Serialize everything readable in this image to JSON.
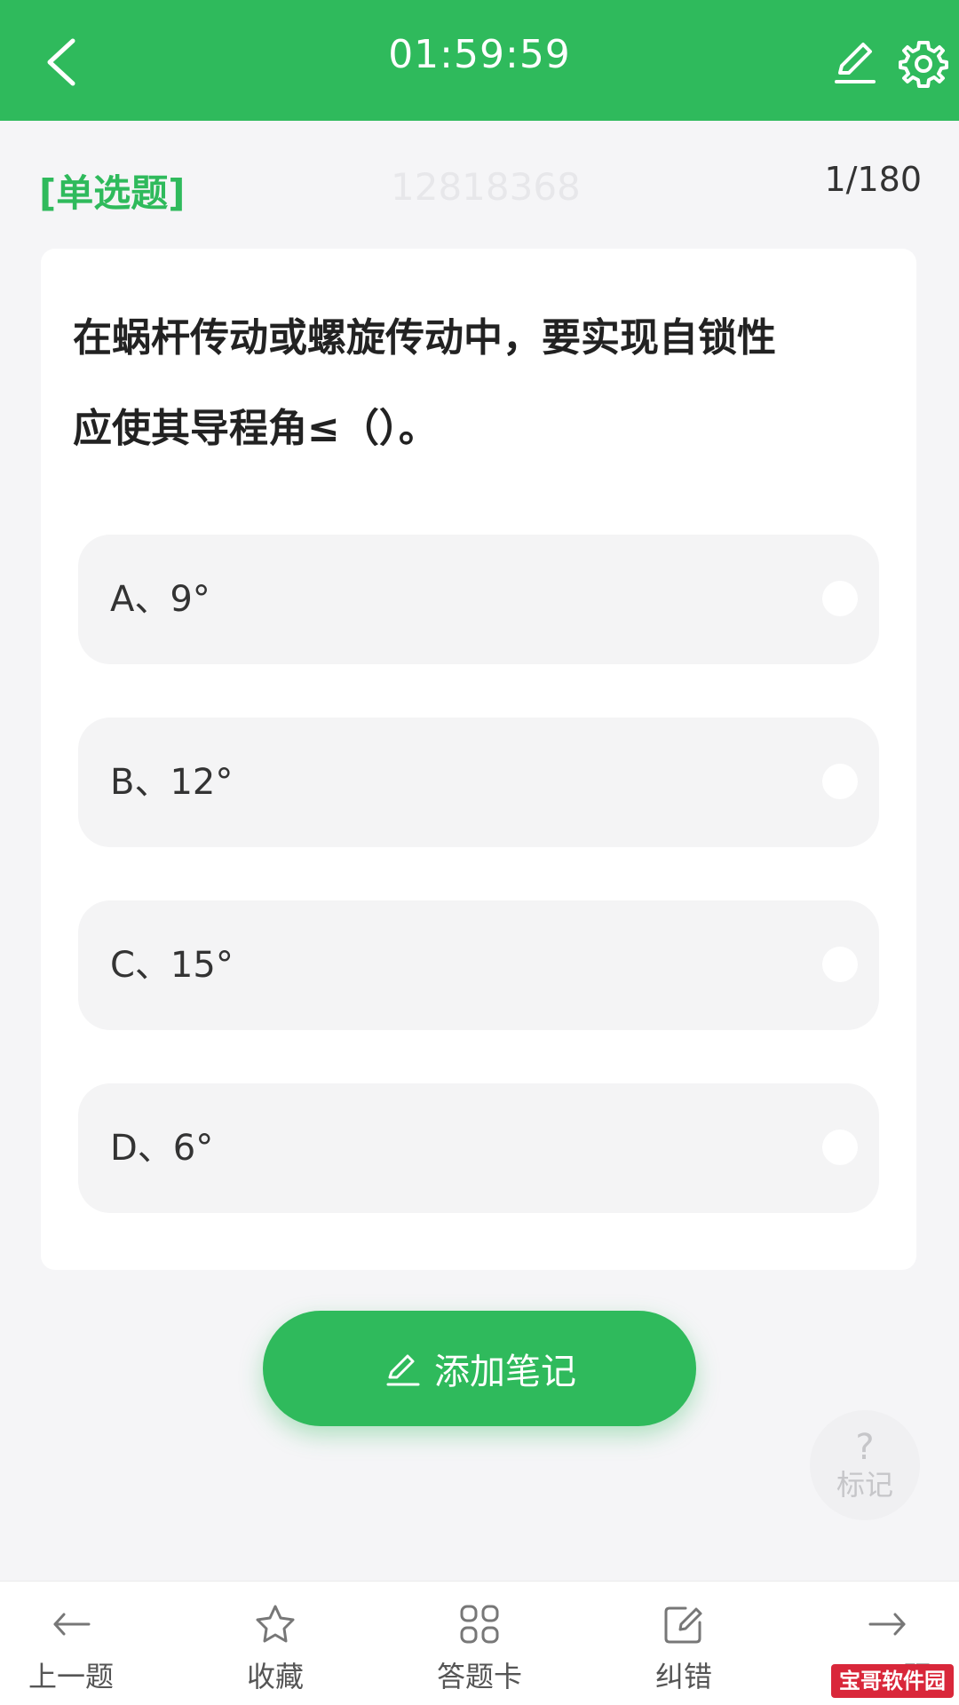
{
  "header": {
    "timer": "01:59:59"
  },
  "meta": {
    "type": "[单选题]",
    "id": "12818368",
    "count": "1/180"
  },
  "question": {
    "line1": "在蜗杆传动或螺旋传动中，要实现自锁性",
    "line2": "应使其导程角≤（）。"
  },
  "options": [
    {
      "label": "A、9°"
    },
    {
      "label": "B、12°"
    },
    {
      "label": "C、15°"
    },
    {
      "label": "D、6°"
    }
  ],
  "note_button": {
    "label": "添加笔记"
  },
  "mark": {
    "symbol": "?",
    "label": "标记"
  },
  "bottom_nav": [
    {
      "label": "上一题",
      "icon": "arrow-left-icon"
    },
    {
      "label": "收藏",
      "icon": "star-icon"
    },
    {
      "label": "答题卡",
      "icon": "grid-icon"
    },
    {
      "label": "纠错",
      "icon": "edit-icon"
    },
    {
      "label": "下一题",
      "icon": "arrow-right-icon"
    }
  ],
  "watermark": {
    "text": "宝哥软件园"
  },
  "colors": {
    "accent": "#2fba5c",
    "card": "#ffffff",
    "option_bg": "#f4f4f5"
  }
}
